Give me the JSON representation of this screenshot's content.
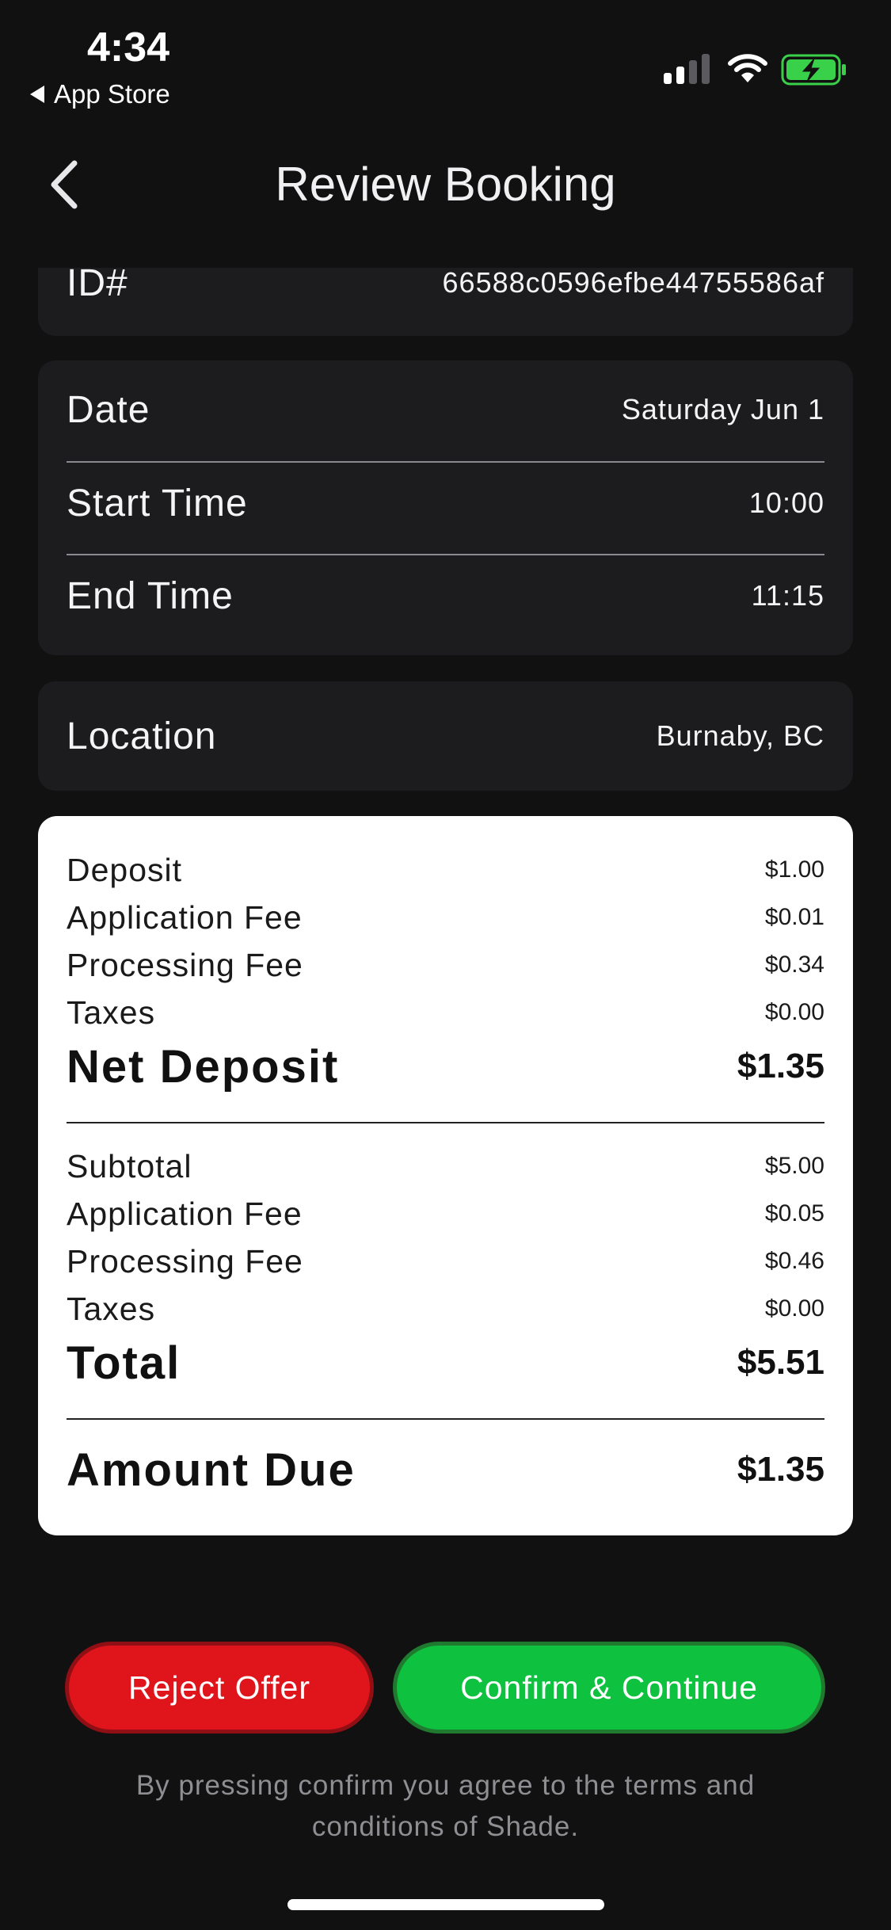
{
  "status_bar": {
    "time": "4:34",
    "back_app": "App Store"
  },
  "header": {
    "title": "Review Booking"
  },
  "id_card": {
    "label": "ID#",
    "value": "66588c0596efbe44755586af"
  },
  "schedule": {
    "date_label": "Date",
    "date_value": "Saturday Jun 1",
    "start_label": "Start Time",
    "start_value": "10:00",
    "end_label": "End Time",
    "end_value": "11:15"
  },
  "location": {
    "label": "Location",
    "value": "Burnaby, BC"
  },
  "deposit": {
    "deposit_label": "Deposit",
    "deposit_value": "$1.00",
    "app_fee_label": "Application Fee",
    "app_fee_value": "$0.01",
    "processing_label": "Processing Fee",
    "processing_value": "$0.34",
    "taxes_label": "Taxes",
    "taxes_value": "$0.00",
    "net_label": "Net Deposit",
    "net_value": "$1.35"
  },
  "totals": {
    "subtotal_label": "Subtotal",
    "subtotal_value": "$5.00",
    "app_fee_label": "Application Fee",
    "app_fee_value": "$0.05",
    "processing_label": "Processing Fee",
    "processing_value": "$0.46",
    "taxes_label": "Taxes",
    "taxes_value": "$0.00",
    "total_label": "Total",
    "total_value": "$5.51"
  },
  "amount_due": {
    "label": "Amount Due",
    "value": "$1.35"
  },
  "actions": {
    "reject_label": "Reject Offer",
    "confirm_label": "Confirm & Continue"
  },
  "terms_text": "By pressing confirm you agree to the terms and conditions of Shade.",
  "colors": {
    "background": "#111112",
    "card": "#1c1c1f",
    "reject": "#e0151c",
    "confirm": "#0ec13f",
    "battery": "#3ad14a"
  },
  "icons": [
    "signal-icon",
    "wifi-icon",
    "battery-charging-icon",
    "chevron-left-icon"
  ]
}
